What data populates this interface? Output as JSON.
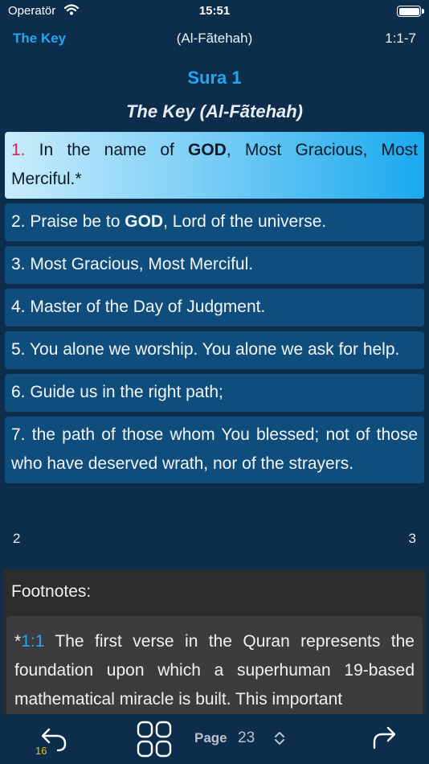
{
  "status_bar": {
    "carrier": "Operatör",
    "time": "15:51"
  },
  "nav": {
    "back_title": "The Key",
    "center_title": "(Al-Fãtehah)",
    "verse_range": "1:1-7"
  },
  "sura": {
    "number_label": "Sura 1",
    "title": "The Key (Al-Fãtehah)"
  },
  "verses": [
    {
      "num": "1.",
      "pre": " In the name of ",
      "bold": "GOD",
      "post": ", Most Gracious, Most Merciful.*",
      "selected": true
    },
    {
      "num": "2.",
      "pre": " Praise be to ",
      "bold": "GOD",
      "post": ", Lord of the universe.",
      "selected": false
    },
    {
      "num": "3.",
      "pre": " Most Gracious, Most Merciful.",
      "bold": "",
      "post": "",
      "selected": false
    },
    {
      "num": "4.",
      "pre": " Master of the Day of Judgment.",
      "bold": "",
      "post": "",
      "selected": false
    },
    {
      "num": "5.",
      "pre": " You alone we worship. You alone we ask for help.",
      "bold": "",
      "post": "",
      "selected": false
    },
    {
      "num": "6.",
      "pre": " Guide us in the right path;",
      "bold": "",
      "post": "",
      "selected": false
    },
    {
      "num": "7.",
      "pre": " the path of those whom You blessed; not of those who have deserved wrath, nor of the strayers.",
      "bold": "",
      "post": "",
      "selected": false
    }
  ],
  "page_marks": {
    "left": "2",
    "right": "3"
  },
  "footnotes": {
    "title": "Footnotes:",
    "marker": "*",
    "ref": "1:1",
    "text": " The first verse in the Quran represents the foundation upon which a superhuman 19-based mathematical miracle is built. This important"
  },
  "toolbar": {
    "back_count": "16",
    "page_label": "Page",
    "page_value": "23"
  },
  "colors": {
    "background": "#0d2d4c",
    "accent": "#22a7f0",
    "verse_bg": "#0f4d7c",
    "verse_number_selected": "#e0234e",
    "back_count": "#e8c21a"
  }
}
